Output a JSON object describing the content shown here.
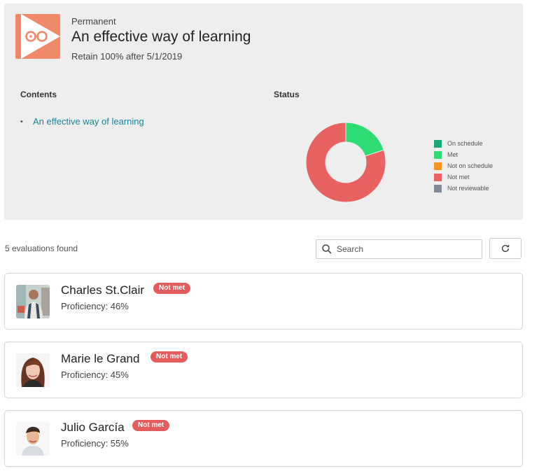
{
  "header": {
    "kicker": "Permanent",
    "title": "An effective way of learning",
    "subtitle": "Retain 100% after 5/1/2019",
    "logo_icon": "play-glasses-logo"
  },
  "contents": {
    "label": "Contents",
    "items": [
      "An effective way of learning"
    ]
  },
  "status": {
    "label": "Status",
    "chart_data": {
      "type": "pie",
      "donut": true,
      "categories": [
        "On schedule",
        "Met",
        "Not on schedule",
        "Not met",
        "Not reviewable"
      ],
      "values": [
        0,
        1,
        0,
        4,
        0
      ],
      "colors": [
        "#1aa77c",
        "#2edc73",
        "#f7931e",
        "#e86262",
        "#808b96"
      ],
      "legend": "right"
    }
  },
  "toolbar": {
    "found_text": "5 evaluations found",
    "search_placeholder": "Search",
    "refresh_icon": "refresh-icon"
  },
  "evaluations": [
    {
      "name": "Charles St.Clair",
      "badge": "Not met",
      "proficiency": "Proficiency: 46%"
    },
    {
      "name": "Marie le Grand",
      "badge": "Not met",
      "proficiency": "Proficiency: 45%"
    },
    {
      "name": "Julio García",
      "badge": "Not met",
      "proficiency": "Proficiency: 55%"
    }
  ]
}
